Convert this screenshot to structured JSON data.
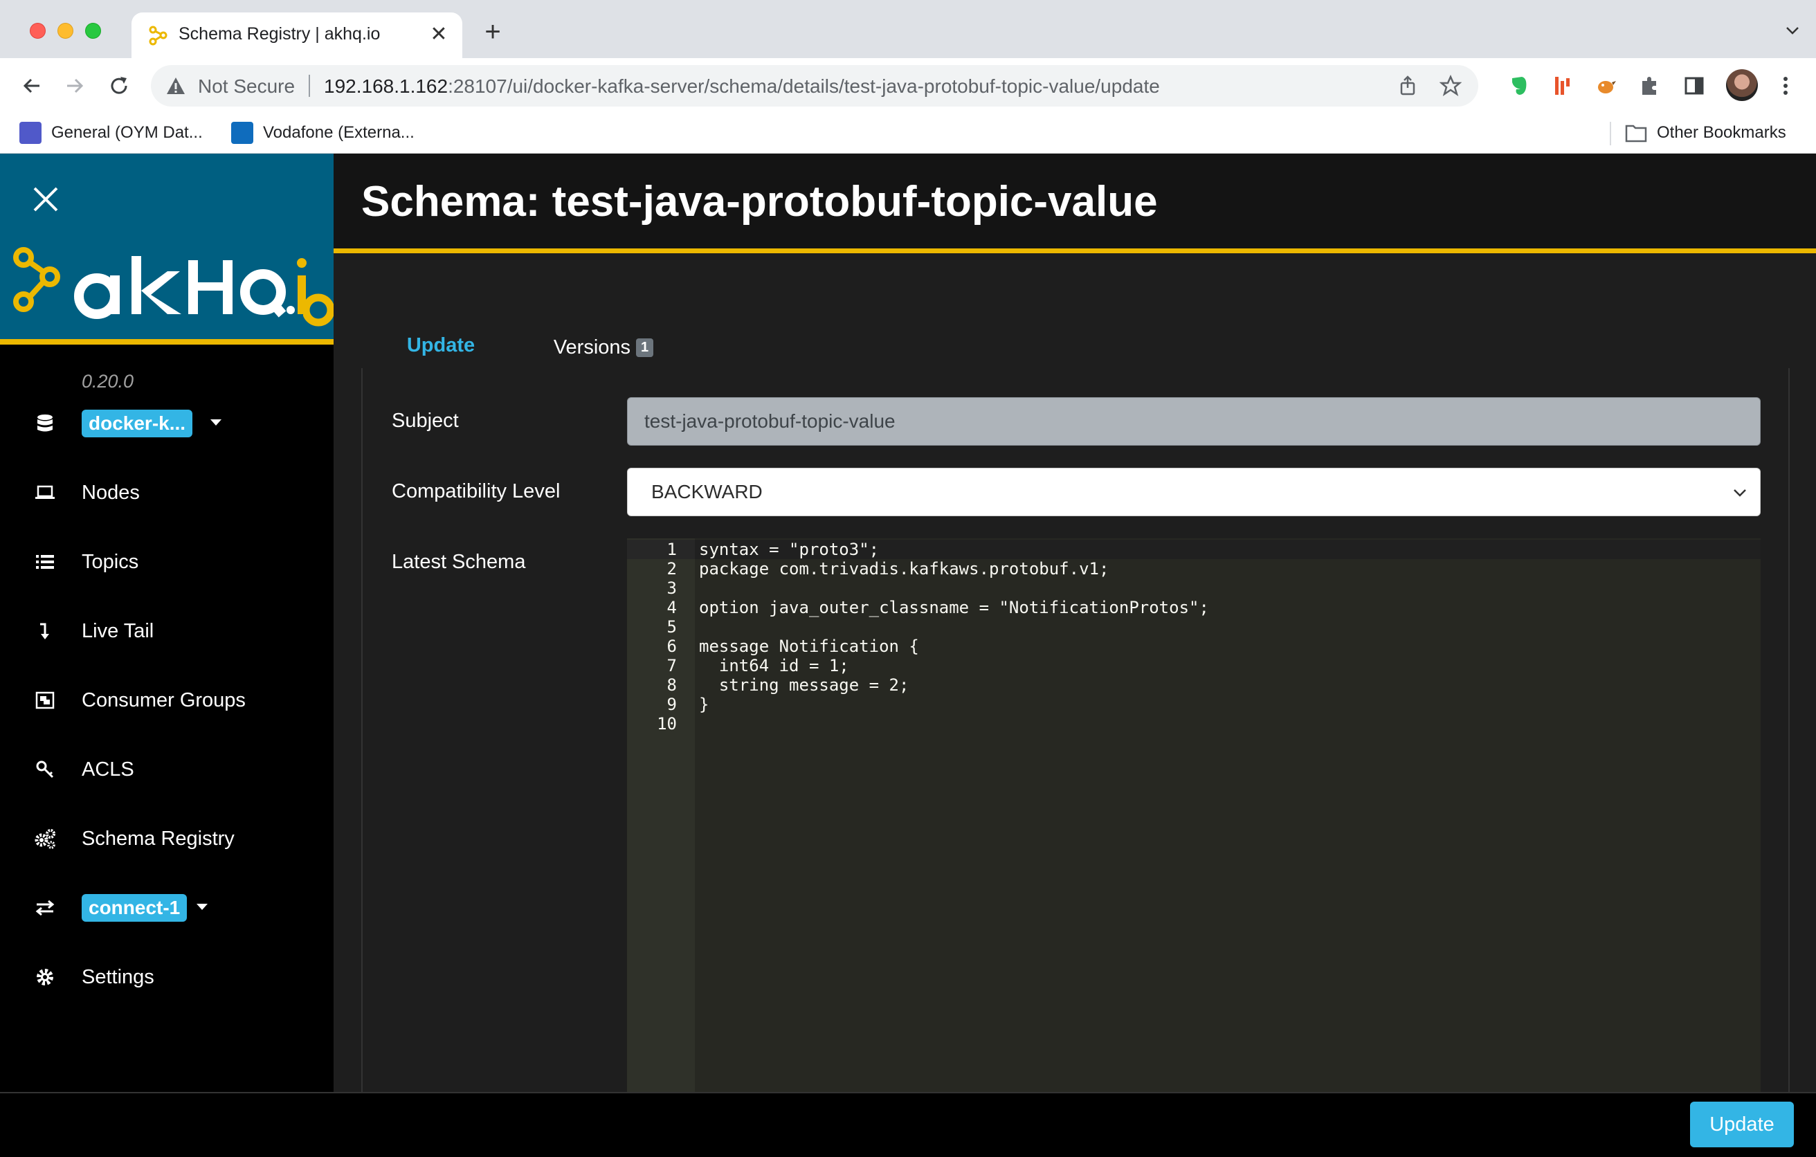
{
  "browser": {
    "tab_title": "Schema Registry | akhq.io",
    "security_label": "Not Secure",
    "url_host": "192.168.1.162",
    "url_path": ":28107/ui/docker-kafka-server/schema/details/test-java-protobuf-topic-value/update",
    "bookmarks": [
      {
        "label": "General (OYM Dat..."
      },
      {
        "label": "Vodafone (Externa..."
      }
    ],
    "other_bookmarks": "Other Bookmarks"
  },
  "sidebar": {
    "version": "0.20.0",
    "cluster_badge": "docker-k...",
    "items": [
      {
        "label": "Nodes"
      },
      {
        "label": "Topics"
      },
      {
        "label": "Live Tail"
      },
      {
        "label": "Consumer Groups"
      },
      {
        "label": "ACLS"
      },
      {
        "label": "Schema Registry"
      }
    ],
    "connect_badge": "connect-1",
    "settings_label": "Settings"
  },
  "page": {
    "title": "Schema: test-java-protobuf-topic-value",
    "tabs": {
      "update": "Update",
      "versions": "Versions",
      "versions_count": "1"
    }
  },
  "form": {
    "subject_label": "Subject",
    "subject_value": "test-java-protobuf-topic-value",
    "compat_label": "Compatibility Level",
    "compat_value": "BACKWARD",
    "schema_label": "Latest Schema"
  },
  "schema_lines": [
    {
      "n": "1",
      "code": "syntax = \"proto3\";"
    },
    {
      "n": "2",
      "code": "package com.trivadis.kafkaws.protobuf.v1;"
    },
    {
      "n": "3",
      "code": ""
    },
    {
      "n": "4",
      "code": "option java_outer_classname = \"NotificationProtos\";"
    },
    {
      "n": "5",
      "code": ""
    },
    {
      "n": "6",
      "code": "message Notification {"
    },
    {
      "n": "7",
      "code": "  int64 id = 1;"
    },
    {
      "n": "8",
      "code": "  string message = 2;"
    },
    {
      "n": "9",
      "code": "}"
    },
    {
      "n": "10",
      "code": ""
    }
  ],
  "footer": {
    "update_label": "Update"
  },
  "colors": {
    "accent": "#33b5e5",
    "brand_yellow": "#ecb800",
    "logo_bg": "#005f81"
  }
}
